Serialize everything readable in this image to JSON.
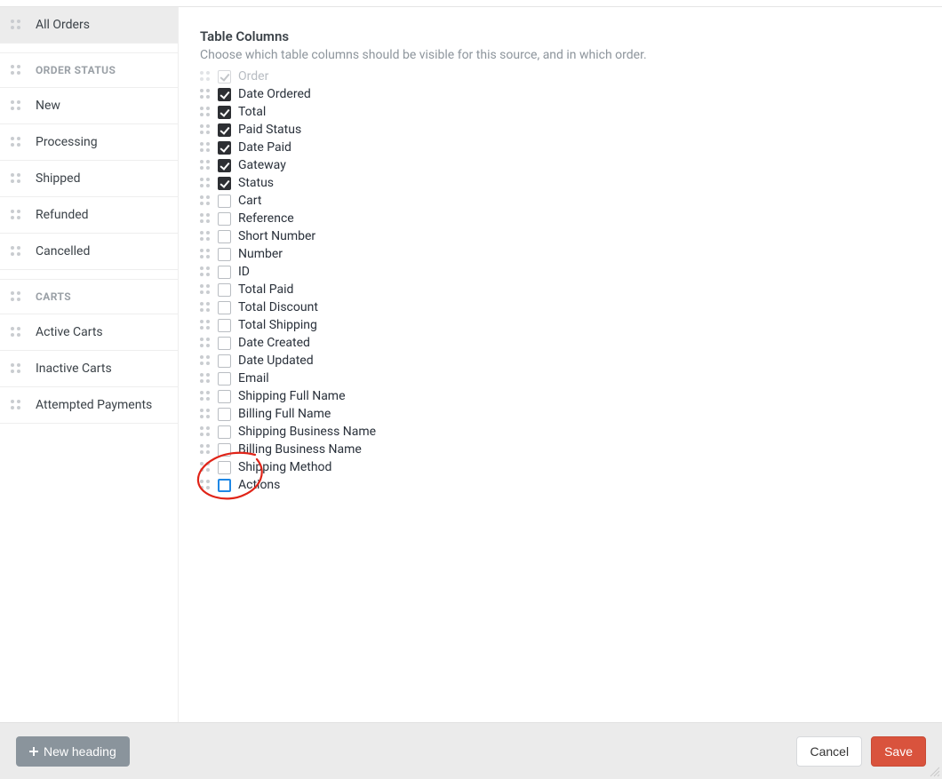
{
  "sidebar": {
    "items": [
      {
        "label": "All Orders",
        "active": true
      },
      {
        "heading": "ORDER STATUS"
      },
      {
        "label": "New"
      },
      {
        "label": "Processing"
      },
      {
        "label": "Shipped"
      },
      {
        "label": "Refunded"
      },
      {
        "label": "Cancelled"
      },
      {
        "heading": "CARTS"
      },
      {
        "label": "Active Carts"
      },
      {
        "label": "Inactive Carts"
      },
      {
        "label": "Attempted Payments"
      }
    ]
  },
  "main": {
    "title": "Table Columns",
    "subtitle": "Choose which table columns should be visible for this source, and in which order.",
    "columns": [
      {
        "label": "Order",
        "checked": true,
        "disabled": true
      },
      {
        "label": "Date Ordered",
        "checked": true
      },
      {
        "label": "Total",
        "checked": true
      },
      {
        "label": "Paid Status",
        "checked": true
      },
      {
        "label": "Date Paid",
        "checked": true
      },
      {
        "label": "Gateway",
        "checked": true
      },
      {
        "label": "Status",
        "checked": true
      },
      {
        "label": "Cart",
        "checked": false
      },
      {
        "label": "Reference",
        "checked": false
      },
      {
        "label": "Short Number",
        "checked": false
      },
      {
        "label": "Number",
        "checked": false
      },
      {
        "label": "ID",
        "checked": false
      },
      {
        "label": "Total Paid",
        "checked": false
      },
      {
        "label": "Total Discount",
        "checked": false
      },
      {
        "label": "Total Shipping",
        "checked": false
      },
      {
        "label": "Date Created",
        "checked": false
      },
      {
        "label": "Date Updated",
        "checked": false
      },
      {
        "label": "Email",
        "checked": false
      },
      {
        "label": "Shipping Full Name",
        "checked": false
      },
      {
        "label": "Billing Full Name",
        "checked": false
      },
      {
        "label": "Shipping Business Name",
        "checked": false
      },
      {
        "label": "Billing Business Name",
        "checked": false
      },
      {
        "label": "Shipping Method",
        "checked": false
      },
      {
        "label": "Actions",
        "checked": false,
        "highlight": true
      }
    ]
  },
  "footer": {
    "new_heading": "New heading",
    "cancel": "Cancel",
    "save": "Save"
  }
}
